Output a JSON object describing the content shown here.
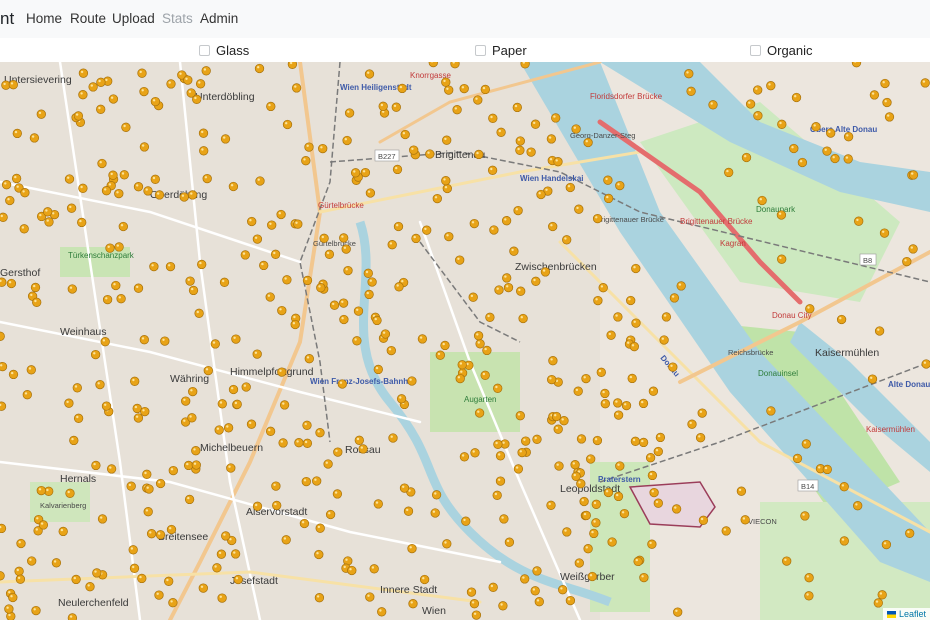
{
  "navbar": {
    "brand": "nt",
    "links": [
      {
        "label": "Home",
        "disabled": false
      },
      {
        "label": "Route",
        "disabled": false
      },
      {
        "label": "Upload",
        "disabled": false
      },
      {
        "label": "Stats",
        "disabled": true
      },
      {
        "label": "Admin",
        "disabled": false
      }
    ]
  },
  "filters": [
    {
      "label": "Glass",
      "checked": false
    },
    {
      "label": "Paper",
      "checked": false
    },
    {
      "label": "Organic",
      "checked": false
    }
  ],
  "map": {
    "marker_color": "#e8a317",
    "district_labels": [
      "Untersievering",
      "Unterdöbling",
      "Oberdöbling",
      "Brigittenau",
      "Zwischenbrücken",
      "Weinhaus",
      "Währing",
      "Himmelpfortgrund",
      "Michelbeuern",
      "Rossau",
      "Hernals",
      "Alservorstadt",
      "Leopoldstadt",
      "Breitensee",
      "Josefstadt",
      "Innere Stadt",
      "Neulerchenfeld",
      "Weißgerber",
      "Wien",
      "Kaisermühlen",
      "Gersthof",
      "Donaupark",
      "Donauinsel",
      "Augarten",
      "Reichsbrücke",
      "Brigittenauer Brücke",
      "Georg-Danzer-Steg",
      "Gürtelbrücke",
      "Kagran"
    ],
    "station_labels": [
      "Wien Heiligenstadt",
      "Wien Handelskai",
      "Wien Franz-Josefs-Bahnhof",
      "Praterstern"
    ],
    "road_labels": [
      "Floridsdorfer Brücke",
      "Brigittenauer Brücke",
      "Gürtelbrücke",
      "Knorrgasse",
      "Kaisermühlen",
      "Donau City"
    ],
    "shields": [
      "B227",
      "B8",
      "B14"
    ],
    "water_labels": [
      "Donau",
      "Obere Alte Donau",
      "Alte Donau"
    ],
    "park_labels": [
      "Türkenschanzpark",
      "Kalvarienberg",
      "VIECON"
    ],
    "attribution": "Leaflet"
  }
}
